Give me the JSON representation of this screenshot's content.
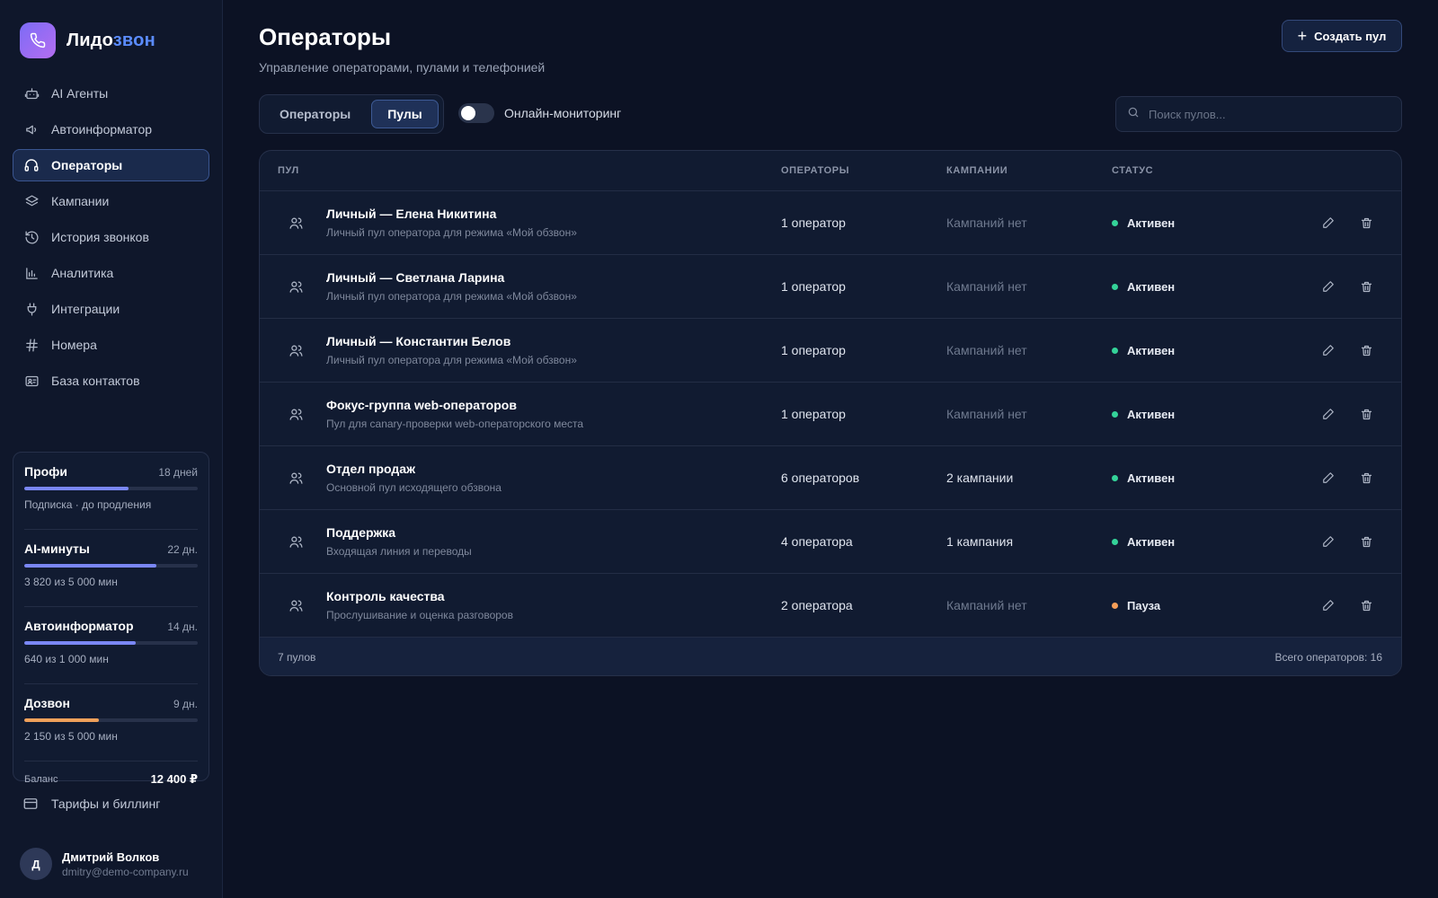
{
  "app": {
    "name_main": "Лидо",
    "name_accent": "звон"
  },
  "sidebar": {
    "items": [
      {
        "label": "AI Агенты",
        "icon": "robot-icon",
        "active": false
      },
      {
        "label": "Автоинформатор",
        "icon": "megaphone-icon",
        "active": false
      },
      {
        "label": "Операторы",
        "icon": "headset-icon",
        "active": true
      },
      {
        "label": "Кампании",
        "icon": "layers-icon",
        "active": false
      },
      {
        "label": "История звонков",
        "icon": "history-icon",
        "active": false
      },
      {
        "label": "Аналитика",
        "icon": "bar-chart-icon",
        "active": false
      },
      {
        "label": "Интеграции",
        "icon": "plug-icon",
        "active": false
      },
      {
        "label": "Номера",
        "icon": "hash-icon",
        "active": false
      },
      {
        "label": "База контактов",
        "icon": "contact-card-icon",
        "active": false
      }
    ],
    "plan": {
      "blocks": [
        {
          "title": "Профи",
          "days": "18 дней",
          "sub": "Подписка · до продления",
          "progress": 0.6,
          "color": "#7a87f5"
        },
        {
          "title": "AI-минуты",
          "days": "22 дн.",
          "sub": "3 820 из 5 000 мин",
          "progress": 0.764,
          "color": "#7a87f5"
        },
        {
          "title": "Автоинформатор",
          "days": "14 дн.",
          "sub": "640 из 1 000 мин",
          "progress": 0.64,
          "color": "#7a87f5"
        },
        {
          "title": "Дозвон",
          "days": "9 дн.",
          "sub": "2 150 из 5 000 мин",
          "progress": 0.43,
          "color": "#f0a05a"
        }
      ],
      "balance_label": "Баланс",
      "balance_value": "12 400 ₽"
    },
    "billing_label": "Тарифы и биллинг",
    "user": {
      "initial": "Д",
      "name": "Дмитрий Волков",
      "email": "dmitry@demo-company.ru"
    }
  },
  "header": {
    "title": "Операторы",
    "subtitle": "Управление операторами, пулами и телефонией",
    "create_button": "Создать пул"
  },
  "tabs": [
    {
      "label": "Операторы",
      "active": false
    },
    {
      "label": "Пулы",
      "active": true
    }
  ],
  "monitoring": {
    "label": "Онлайн-мониторинг",
    "enabled": false
  },
  "search": {
    "placeholder": "Поиск пулов...",
    "value": ""
  },
  "table": {
    "columns": [
      "ПУЛ",
      "ОПЕРАТОРЫ",
      "КАМПАНИИ",
      "СТАТУС"
    ],
    "rows": [
      {
        "name": "Личный — Елена Никитина",
        "desc": "Личный пул оператора для режима «Мой обзвон»",
        "operators": "1 оператор",
        "campaigns": "Кампаний нет",
        "campaigns_muted": true,
        "status": "Активен",
        "status_color": "#34d399"
      },
      {
        "name": "Личный — Светлана Ларина",
        "desc": "Личный пул оператора для режима «Мой обзвон»",
        "operators": "1 оператор",
        "campaigns": "Кампаний нет",
        "campaigns_muted": true,
        "status": "Активен",
        "status_color": "#34d399"
      },
      {
        "name": "Личный — Константин Белов",
        "desc": "Личный пул оператора для режима «Мой обзвон»",
        "operators": "1 оператор",
        "campaigns": "Кампаний нет",
        "campaigns_muted": true,
        "status": "Активен",
        "status_color": "#34d399"
      },
      {
        "name": "Фокус-группа web-операторов",
        "desc": "Пул для canary-проверки web-операторского места",
        "operators": "1 оператор",
        "campaigns": "Кампаний нет",
        "campaigns_muted": true,
        "status": "Активен",
        "status_color": "#34d399"
      },
      {
        "name": "Отдел продаж",
        "desc": "Основной пул исходящего обзвона",
        "operators": "6 операторов",
        "campaigns": "2 кампании",
        "campaigns_muted": false,
        "status": "Активен",
        "status_color": "#34d399"
      },
      {
        "name": "Поддержка",
        "desc": "Входящая линия и переводы",
        "operators": "4 оператора",
        "campaigns": "1 кампания",
        "campaigns_muted": false,
        "status": "Активен",
        "status_color": "#34d399"
      },
      {
        "name": "Контроль качества",
        "desc": "Прослушивание и оценка разговоров",
        "operators": "2 оператора",
        "campaigns": "Кампаний нет",
        "campaigns_muted": true,
        "status": "Пауза",
        "status_color": "#f59e58"
      }
    ],
    "footer_left": "7 пулов",
    "footer_right": "Всего операторов: 16"
  }
}
